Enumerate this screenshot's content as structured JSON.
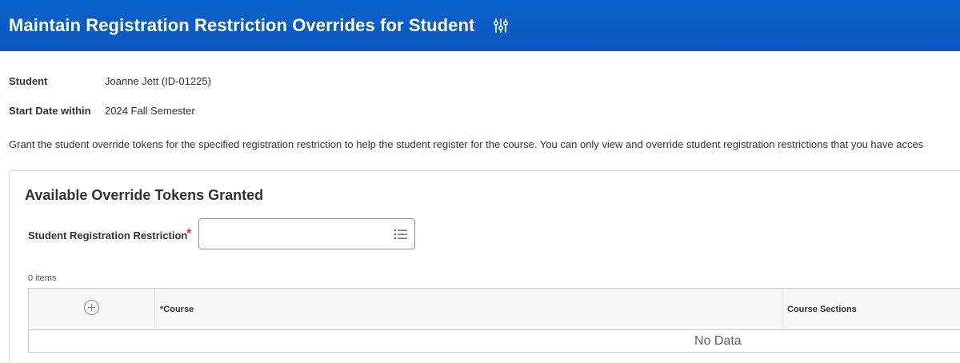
{
  "header": {
    "title": "Maintain Registration Restriction Overrides for Student",
    "icon": "related-actions-icon",
    "background": "#0a5bc4"
  },
  "fields": {
    "student_label": "Student",
    "student_value": "Joanne Jett (ID-01225)",
    "start_date_label": "Start Date within",
    "start_date_value": "2024 Fall Semester"
  },
  "description": "Grant the student override tokens for the specified registration restriction to help the student register for the course. You can only view and override student registration restrictions that you have acces",
  "panel": {
    "title": "Available Override Tokens Granted",
    "restriction_label": "Student Registration Restriction",
    "required_marker": "*",
    "restriction_value": "",
    "restriction_icon": "list-icon",
    "items_count": "0 items",
    "grid": {
      "columns": [
        "*Course",
        "Course Sections"
      ],
      "add_icon": "add-row-icon",
      "empty_text": "No Data"
    }
  }
}
